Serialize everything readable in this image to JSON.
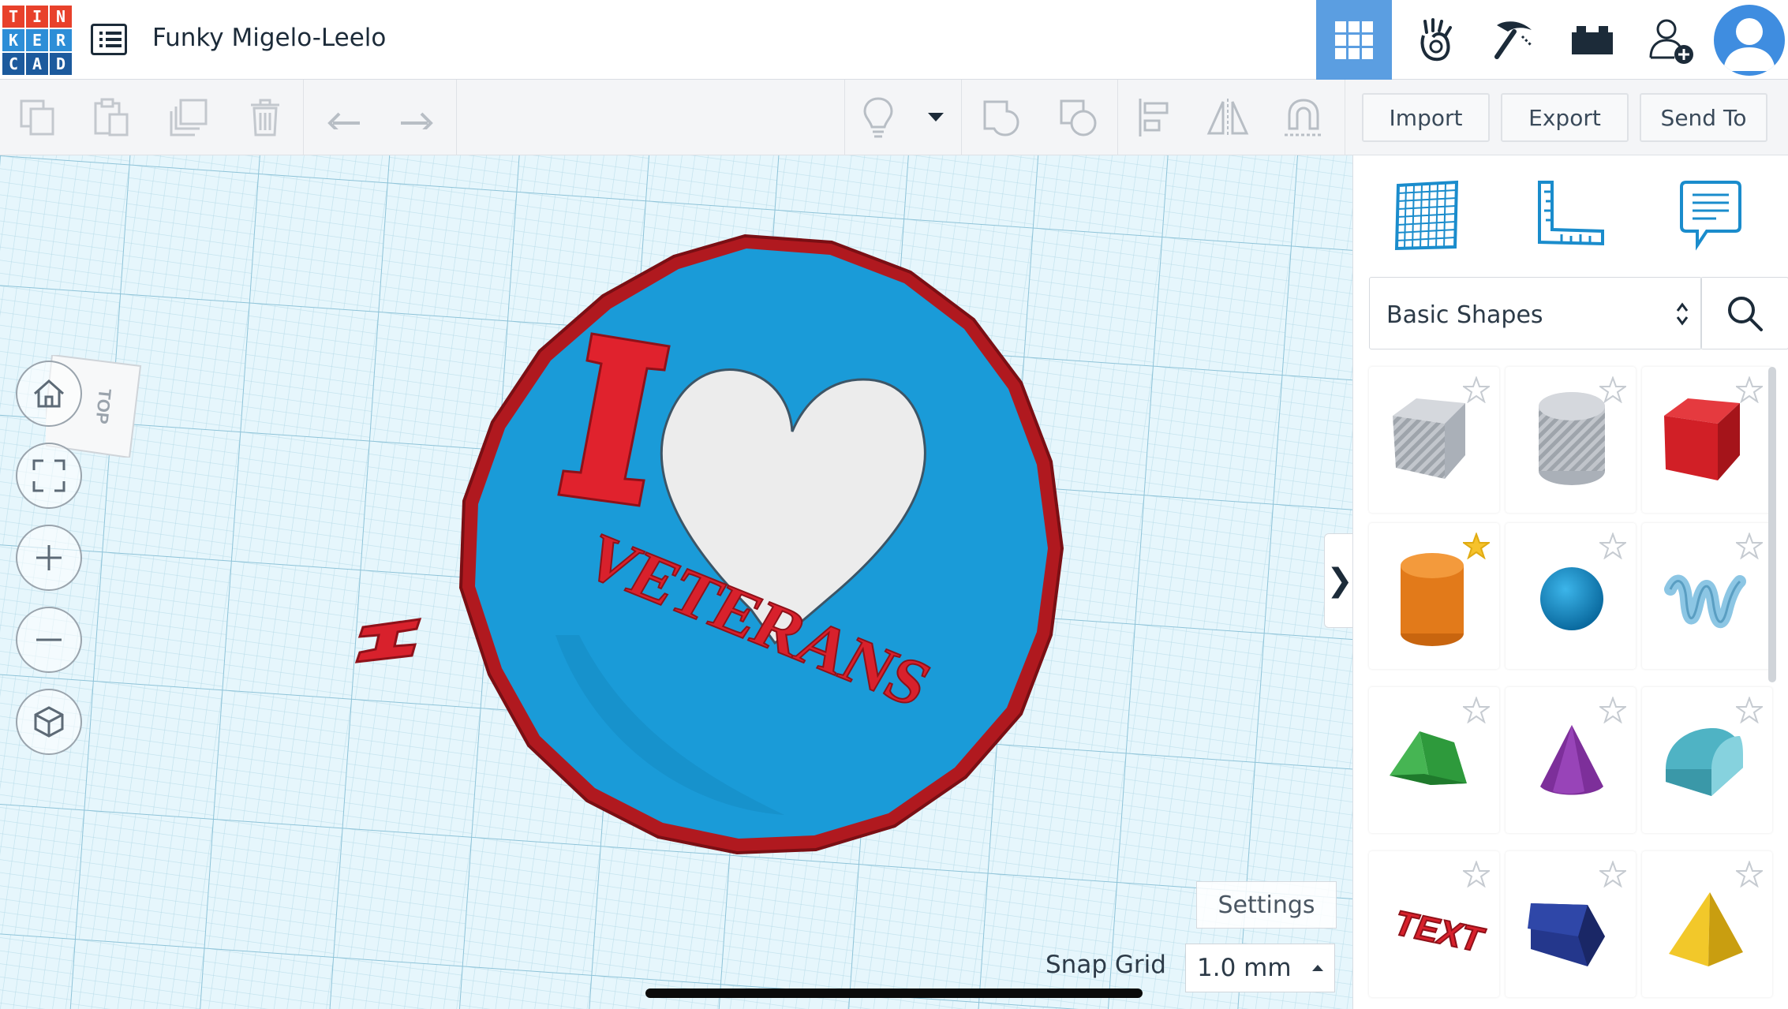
{
  "app": {
    "logo_letters": [
      "T",
      "I",
      "N",
      "K",
      "E",
      "R",
      "C",
      "A",
      "D"
    ],
    "logo_colors": [
      "#e8412b",
      "#e8412b",
      "#e8412b",
      "#2d8ed7",
      "#2d8ed7",
      "#2d8ed7",
      "#1c5a9d",
      "#1c5a9d",
      "#1c5a9d"
    ],
    "project_title": "Funky Migelo-Leelo",
    "design_list_icon": "list-icon",
    "accent_color": "#5b9ee1"
  },
  "top_nav": [
    {
      "name": "3d-design-icon",
      "active": true
    },
    {
      "name": "blocks-hand-icon",
      "active": false
    },
    {
      "name": "pickaxe-icon",
      "active": false
    },
    {
      "name": "lego-brick-icon",
      "active": false
    },
    {
      "name": "add-user-icon",
      "active": false
    },
    {
      "name": "avatar-icon",
      "active": false
    }
  ],
  "toolbar": {
    "left_tools": [
      "copy-icon",
      "paste-icon",
      "duplicate-icon",
      "trash-icon",
      "undo-icon",
      "redo-icon"
    ],
    "right_tools": [
      "lightbulb-icon",
      "dropdown-arrow-icon",
      "group-icon",
      "ungroup-icon",
      "align-icon",
      "mirror-icon",
      "magnet-icon"
    ],
    "import_label": "Import",
    "export_label": "Export",
    "send_to_label": "Send To"
  },
  "workplane": {
    "view_cube_label": "TOP",
    "nav_buttons": [
      "home-icon",
      "fit-view-icon",
      "zoom-in-icon",
      "zoom-out-icon",
      "perspective-cube-icon"
    ],
    "collapse_label": "❯",
    "settings_label": "Settings",
    "snap_grid_label": "Snap Grid",
    "snap_grid_value": "1.0 mm",
    "design": {
      "big_letter": "I",
      "bottom_text": "VETERANS",
      "base_color": "#1a9bd8",
      "rim_color": "#b0191f",
      "letter_color": "#e0222d",
      "heart_color": "#ececec",
      "grid_color": "#d9f1fa"
    }
  },
  "panel": {
    "tabs": [
      "workplane-grid-icon",
      "ruler-icon",
      "notes-icon"
    ],
    "library_label": "Basic Shapes",
    "shapes": [
      {
        "name": "box-hole",
        "favorite": false
      },
      {
        "name": "cylinder-hole",
        "favorite": false
      },
      {
        "name": "box",
        "favorite": false
      },
      {
        "name": "cylinder",
        "favorite": true
      },
      {
        "name": "sphere",
        "favorite": false
      },
      {
        "name": "scribble",
        "favorite": false
      },
      {
        "name": "roof",
        "favorite": false
      },
      {
        "name": "cone",
        "favorite": false
      },
      {
        "name": "round-roof",
        "favorite": false
      },
      {
        "name": "text",
        "favorite": false
      },
      {
        "name": "polygon-prism",
        "favorite": false
      },
      {
        "name": "pyramid",
        "favorite": false
      }
    ],
    "shape_text_label": "TEXT"
  }
}
